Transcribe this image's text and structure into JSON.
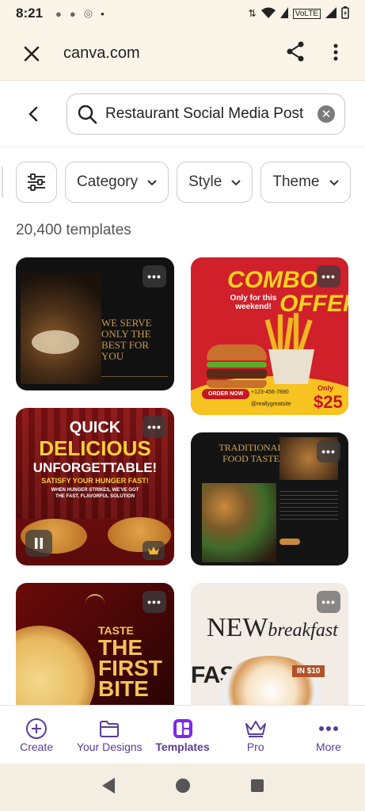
{
  "status": {
    "time": "8:21",
    "network": "VoLTE"
  },
  "browser": {
    "url": "canva.com"
  },
  "search": {
    "value": "Restaurant Social Media Post",
    "placeholder": "Search"
  },
  "filters": [
    {
      "label": "Category"
    },
    {
      "label": "Style"
    },
    {
      "label": "Theme"
    }
  ],
  "results_count": "20,400 templates",
  "templates": {
    "t1": {
      "heading": "WE SERVE ONLY THE BEST FOR YOU"
    },
    "t2": {
      "title1": "COMBO",
      "title2": "OFFER",
      "subtitle": "Only for this weekend!",
      "cta": "ORDER NOW",
      "phone": "+123-456-7890",
      "handle": "@reallygreatsite",
      "price_label": "Only",
      "price": "$25"
    },
    "t3": {
      "line1": "QUICK",
      "line2": "DELICIOUS",
      "line3": "UNFORGETTABLE!",
      "line4": "SATISFY YOUR HUNGER FAST!",
      "line5": "WHEN HUNGER STRIKES, WE'VE GOT THE FAST, FLAVORFUL SOLUTION"
    },
    "t4": {
      "title": "TRADITIONAL FOOD TASTE"
    },
    "t5": {
      "line1": "TASTE",
      "line2": "THE",
      "line3": "FIRST",
      "line4": "BITE"
    },
    "t6": {
      "title1": "NEW",
      "title2": "breakfast",
      "badge": "IN $10",
      "band": "FAST BR"
    }
  },
  "bottom_nav": [
    {
      "label": "Create",
      "icon": "plus-circle-icon"
    },
    {
      "label": "Your Designs",
      "icon": "folder-icon"
    },
    {
      "label": "Templates",
      "icon": "templates-icon",
      "active": true
    },
    {
      "label": "Pro",
      "icon": "crown-icon"
    },
    {
      "label": "More",
      "icon": "more-dots-icon"
    }
  ],
  "colors": {
    "accent": "#7d2ae8",
    "nav_text": "#5a3d9a",
    "chrome_bg": "#fbf4e9"
  }
}
